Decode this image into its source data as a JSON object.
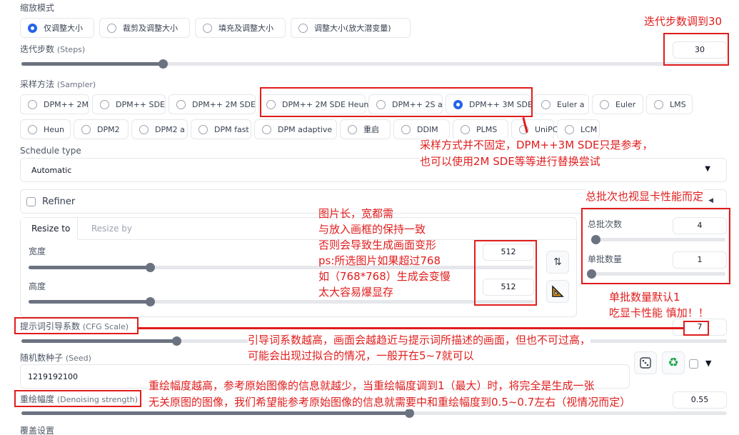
{
  "resize_mode": {
    "label": "缩放模式",
    "options": [
      "仅调整大小",
      "裁剪及调整大小",
      "填充及调整大小",
      "调整大小(放大潜变量)"
    ],
    "selected": "仅调整大小"
  },
  "steps": {
    "label": "迭代步数",
    "label_en": "(Steps)",
    "value": "30",
    "fraction": 0.2
  },
  "sampler": {
    "label": "采样方法",
    "label_en": "(Sampler)",
    "row1": [
      "DPM++ 2M",
      "DPM++ SDE",
      "DPM++ 2M SDE",
      "DPM++ 2M SDE Heun",
      "DPM++ 2S a",
      "DPM++ 3M SDE",
      "Euler a",
      "Euler",
      "LMS"
    ],
    "row2": [
      "Heun",
      "DPM2",
      "DPM2 a",
      "DPM fast",
      "DPM adaptive",
      "重启",
      "DDIM",
      "PLMS",
      "UniPC",
      "LCM"
    ],
    "selected": "DPM++ 3M SDE"
  },
  "schedule": {
    "label": "Schedule type",
    "value": "Automatic"
  },
  "refiner": {
    "label": "Refiner"
  },
  "size_tabs": {
    "tab1": "Resize to",
    "tab2": "Resize by"
  },
  "width": {
    "label": "宽度",
    "value": "512",
    "fraction": 0.24
  },
  "height": {
    "label": "高度",
    "value": "512",
    "fraction": 0.24
  },
  "batch_count": {
    "label": "总批次数",
    "value": "4",
    "fraction": 0.03
  },
  "batch_size": {
    "label": "单批数量",
    "value": "1",
    "fraction": 0.0
  },
  "cfg": {
    "label": "提示词引导系数",
    "label_en": "(CFG Scale)",
    "value": "7",
    "fraction": 0.22
  },
  "seed": {
    "label": "随机数种子",
    "label_en": "(Seed)",
    "value": "1219192100"
  },
  "denoise": {
    "label": "重绘幅度",
    "label_en": "(Denoising strength)",
    "value": "0.55",
    "fraction": 0.55
  },
  "override": {
    "label": "覆盖设置"
  },
  "annotations": {
    "steps_note": "迭代步数调到30",
    "sampler_note1": "采样方式并不固定，DPM++3M SDE只是参考，",
    "sampler_note2": "也可以使用2M SDE等等进行替换尝试",
    "batch_note": "总批次也视显卡性能而定",
    "size_note1": "图片长，宽都需",
    "size_note2": "与放入画框的保持一致",
    "size_note3": "否则会导致生成画面变形",
    "size_note4": "ps:所选图片如果超过768",
    "size_note5": "如（768*768）生成会变慢",
    "size_note6": "太大容易爆显存",
    "batchsize_note1": "单批数量默认1",
    "batchsize_note2": "吃显卡性能 慎加！！",
    "cfg_note1": "引导词系数越高，画面会越趋近与提示词所描述的画面，但也不可过高，",
    "cfg_note2": "可能会出现过拟合的情况，一般开在5~7就可以",
    "denoise_note1": "重绘幅度越高，参考原始图像的信息就越少，当重绘幅度调到1（最大）时，将完全是生成一张",
    "denoise_note2": "无关原图的图像，我们希望能参考原始图像的信息就需要中和重绘幅度到0.5~0.7左右（视情况而定）"
  },
  "colors": {
    "accent": "#2563eb",
    "annotation": "#e11d1d",
    "slider": "#6b7280"
  }
}
